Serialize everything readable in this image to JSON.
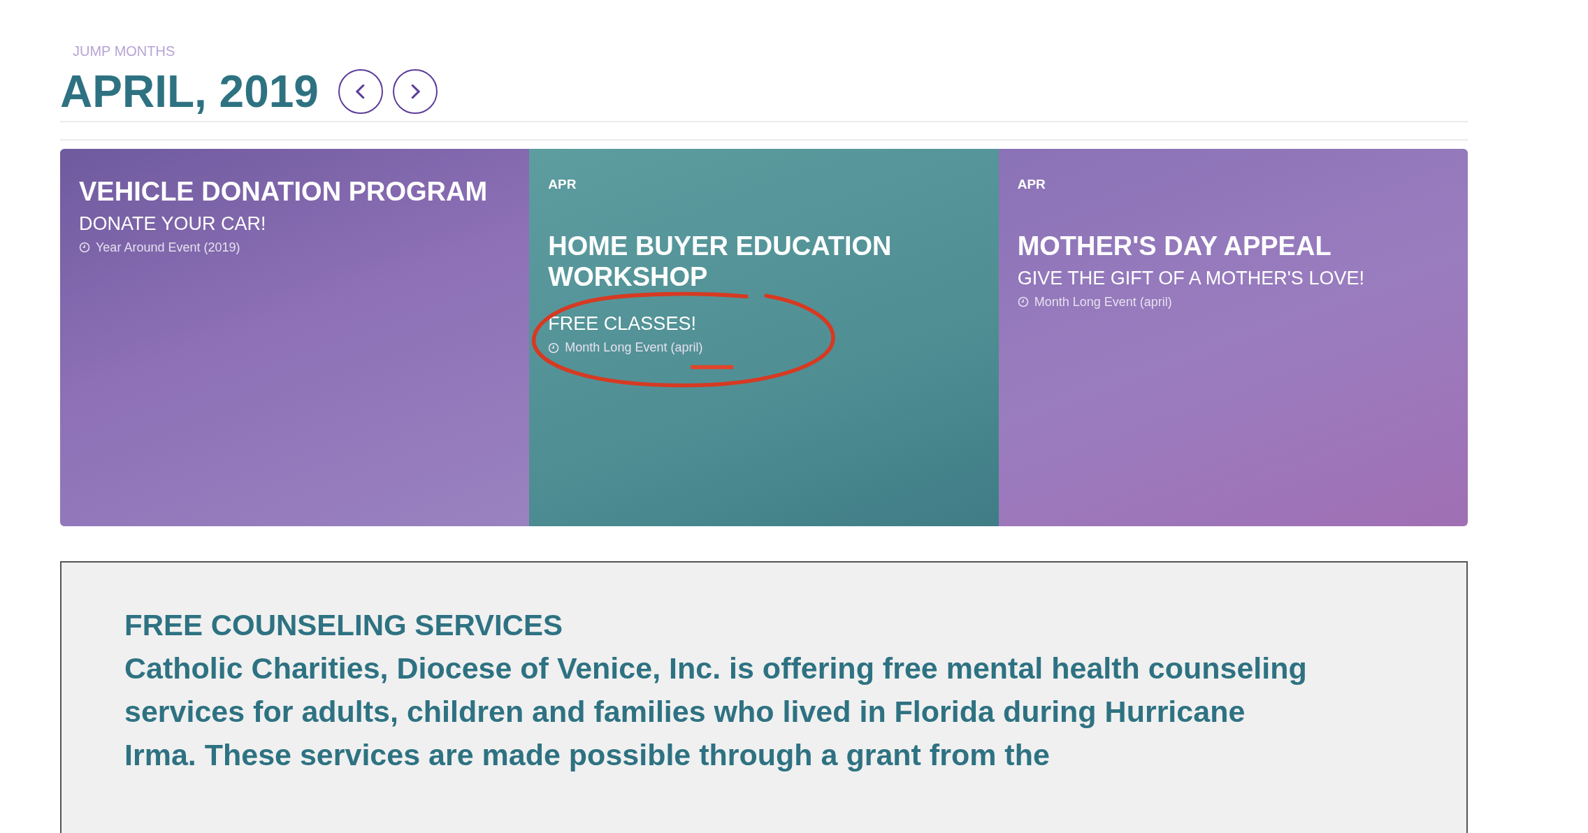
{
  "jump_label": "JUMP MONTHS",
  "month_title": "APRIL, 2019",
  "nav_buttons": [
    {
      "kind": "prev"
    },
    {
      "kind": "next"
    }
  ],
  "events": [
    {
      "kind": "purple",
      "title": "VEHICLE DONATION PROGRAM",
      "subtitle": "DONATE YOUR CAR!",
      "when": "Year Around Event (2019)",
      "annotated": false
    },
    {
      "kind": "teal",
      "date": "APR",
      "title": "HOME BUYER EDUCATION WORKSHOP",
      "subtitle": "FREE CLASSES!",
      "when": "Month Long Event (april)",
      "annotated": true
    },
    {
      "kind": "violet",
      "date": "APR",
      "title": "MOTHER'S DAY APPEAL",
      "subtitle": "GIVE THE GIFT OF A MOTHER'S LOVE!",
      "when": "Month Long Event (april)",
      "annotated": false
    }
  ],
  "notice": {
    "heading": "FREE COUNSELING SERVICES",
    "body": "Catholic Charities, Diocese of Venice, Inc. is offering free mental health counseling services for adults, children and families who lived in Florida during Hurricane Irma. These services are made possible through a grant from the"
  }
}
